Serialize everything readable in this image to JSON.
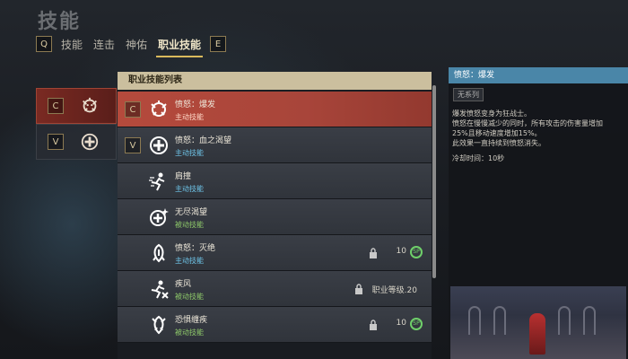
{
  "header": {
    "title": "技能",
    "tabs": [
      {
        "key": "Q"
      },
      {
        "label": "技能"
      },
      {
        "label": "连击"
      },
      {
        "label": "神佑"
      },
      {
        "label": "职业技能",
        "active": true
      },
      {
        "key": "E"
      }
    ]
  },
  "slots": [
    {
      "key": "C",
      "icon": "rage-burst-icon",
      "active": true
    },
    {
      "key": "V",
      "icon": "crimson-desire-icon",
      "active": false
    }
  ],
  "list": {
    "header": "职业技能列表",
    "rows": [
      {
        "key": "C",
        "name": "愤怒：爆发",
        "type": "主动技能",
        "type_kind": "active",
        "icon": "rage-burst-icon",
        "active": true
      },
      {
        "key": "V",
        "name": "愤怒：血之渴望",
        "type": "主动技能",
        "type_kind": "active",
        "icon": "blood-thirst-icon"
      },
      {
        "name": "肩撞",
        "type": "主动技能",
        "type_kind": "active",
        "icon": "shoulder-charge-icon"
      },
      {
        "name": "无尽渴望",
        "type": "被动技能",
        "type_kind": "passive",
        "icon": "endless-desire-icon"
      },
      {
        "name": "愤怒：灭绝",
        "type": "主动技能",
        "type_kind": "active",
        "icon": "extinction-icon",
        "locked": true,
        "points": "10"
      },
      {
        "name": "疾风",
        "type": "被动技能",
        "type_kind": "passive",
        "icon": "gale-icon",
        "locked": true,
        "requirement": "职业等级.20"
      },
      {
        "name": "恐惧缠疾",
        "type": "被动技能",
        "type_kind": "passive",
        "icon": "fear-icon",
        "locked": true,
        "points": "10"
      }
    ]
  },
  "detail": {
    "title": "愤怒：爆发",
    "tag": "无系列",
    "desc_lines": [
      "爆发愤怒变身为狂战士。",
      "愤怒在慢慢减少的同时，所有攻击的伤害量增加",
      "25%且移动速度增加15%。",
      "此效果一直持续到愤怒消失。"
    ],
    "cooldown": "冷却时间：10秒"
  },
  "colors": {
    "accent_gold": "#d9b95c",
    "active_row": "#b54a3c",
    "detail_header": "#4a86a8",
    "active_skill": "#6ec4e8",
    "passive_skill": "#8ec96a"
  }
}
